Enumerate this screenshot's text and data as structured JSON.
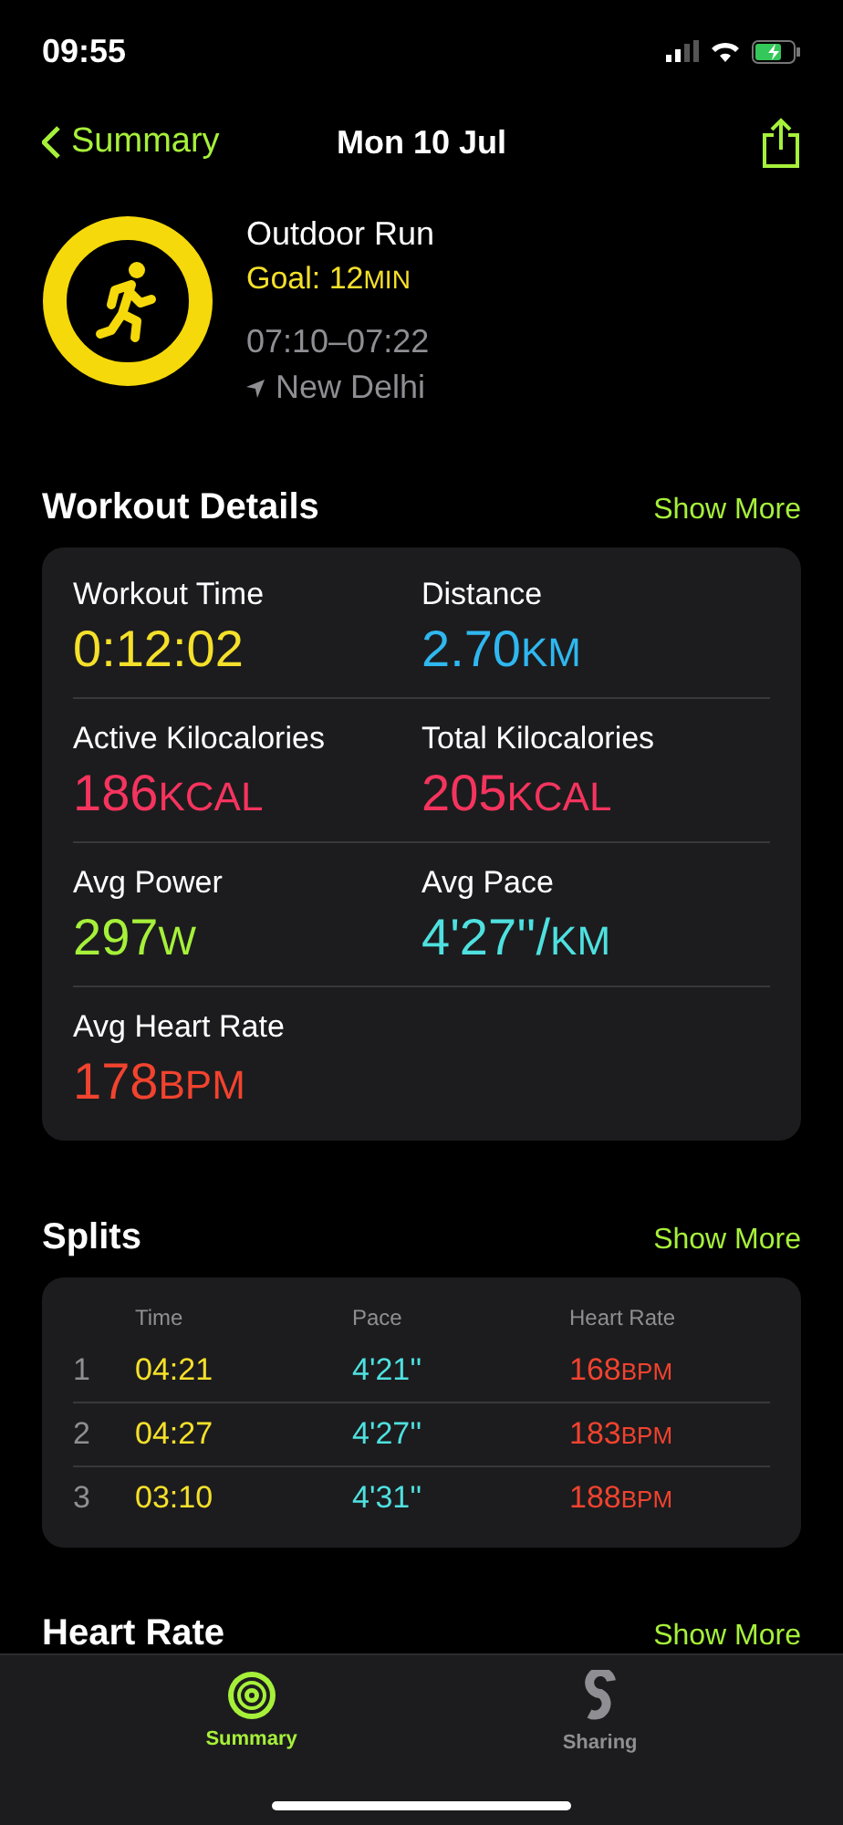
{
  "status_bar": {
    "time": "09:55"
  },
  "nav": {
    "back": "Summary",
    "title": "Mon 10 Jul"
  },
  "workout": {
    "name": "Outdoor Run",
    "goal": "Goal: 12",
    "goal_unit": "MIN",
    "time_range": "07:10–07:22",
    "location": "New Delhi"
  },
  "details": {
    "title": "Workout Details",
    "action": "Show More",
    "metrics": [
      {
        "label": "Workout Time",
        "value": "0:12:02",
        "color": "#f5e02a"
      },
      {
        "label": "Distance",
        "value": "2.70",
        "unit": "KM",
        "color": "#2fb7f0"
      },
      {
        "label": "Active Kilocalories",
        "value": "186",
        "unit": "KCAL",
        "color": "#f5345e"
      },
      {
        "label": "Total Kilocalories",
        "value": "205",
        "unit": "KCAL",
        "color": "#f5345e"
      },
      {
        "label": "Avg Power",
        "value": "297",
        "unit": "W",
        "color": "#a6f03a"
      },
      {
        "label": "Avg Pace",
        "value": "4'27''/",
        "unit": "KM",
        "color": "#4fe0e0"
      },
      {
        "label": "Avg Heart Rate",
        "value": "178",
        "unit": "BPM",
        "color": "#f2432f"
      }
    ]
  },
  "splits": {
    "title": "Splits",
    "action": "Show More",
    "columns": [
      "Time",
      "Pace",
      "Heart Rate"
    ],
    "rows": [
      {
        "index": "1",
        "time": "04:21",
        "pace": "4'21''",
        "heart_rate": "168",
        "unit": "BPM"
      },
      {
        "index": "2",
        "time": "04:27",
        "pace": "4'27''",
        "heart_rate": "183",
        "unit": "BPM"
      },
      {
        "index": "3",
        "time": "03:10",
        "pace": "4'31''",
        "heart_rate": "188",
        "unit": "BPM"
      }
    ]
  },
  "heart_rate": {
    "title": "Heart Rate",
    "action": "Show More"
  },
  "tabs": [
    {
      "label": "Summary",
      "kind": "rings",
      "selected": true
    },
    {
      "label": "Sharing",
      "kind": "sharing",
      "selected": false
    }
  ]
}
